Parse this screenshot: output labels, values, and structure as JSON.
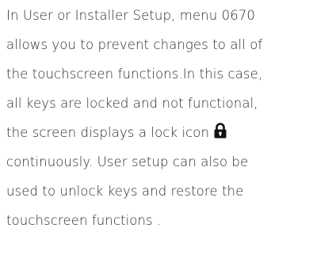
{
  "paragraph": {
    "line_1": "In User or Installer Setup, menu 0670",
    "line_2": "allows you to prevent changes to all of",
    "line_3": "the touchscreen functions.In this case,",
    "line_4": "all keys are locked and not functional,",
    "line_5": "the screen displays a lock icon",
    "line_6": "continuously.  User setup can also be",
    "line_7": "used to unlock keys and restore the",
    "line_8": "touchscreen functions ."
  },
  "icons": {
    "inline_icon": "lock-icon"
  },
  "colors": {
    "text": "#2b2b2b",
    "icon": "#111111",
    "background": "#ffffff"
  }
}
